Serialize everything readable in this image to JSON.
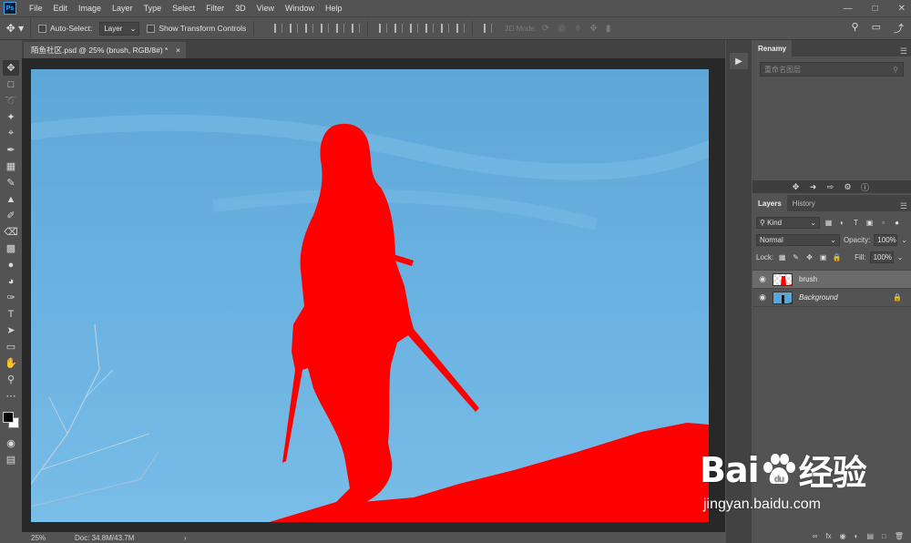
{
  "menubar": {
    "logo": "Ps",
    "items": [
      "File",
      "Edit",
      "Image",
      "Layer",
      "Type",
      "Select",
      "Filter",
      "3D",
      "View",
      "Window",
      "Help"
    ]
  },
  "optionsbar": {
    "auto_select_label": "Auto-Select:",
    "auto_select_value": "Layer",
    "transform_controls_label": "Show Transform Controls",
    "mode_3d_label": "3D Mode:"
  },
  "document": {
    "tab_title": "陌鱼社区.psd @ 25% (brush, RGB/8#) *",
    "close_glyph": "×"
  },
  "statusbar": {
    "zoom": "25%",
    "doc_info": "Doc: 34.8M/43.7M"
  },
  "renamy": {
    "panel_title": "Renamy",
    "search_placeholder": "重命名图层"
  },
  "layers_panel": {
    "tabs": [
      "Layers",
      "History"
    ],
    "filter_kind": "Kind",
    "blend_mode": "Normal",
    "opacity_label": "Opacity:",
    "opacity_value": "100%",
    "lock_label": "Lock:",
    "fill_label": "Fill:",
    "fill_value": "100%",
    "layers": [
      {
        "name": "brush",
        "selected": true,
        "visible": true
      },
      {
        "name": "Background",
        "selected": false,
        "visible": true,
        "locked": true
      }
    ],
    "footer_fx": "fx"
  },
  "watermark": {
    "brand_a": "Bai",
    "brand_b": "经验",
    "url": "jingyan.baidu.com"
  },
  "colors": {
    "foreground": "#000000",
    "background": "#ffffff",
    "fill_red": "#ff0000",
    "sky": "#66afe0"
  }
}
